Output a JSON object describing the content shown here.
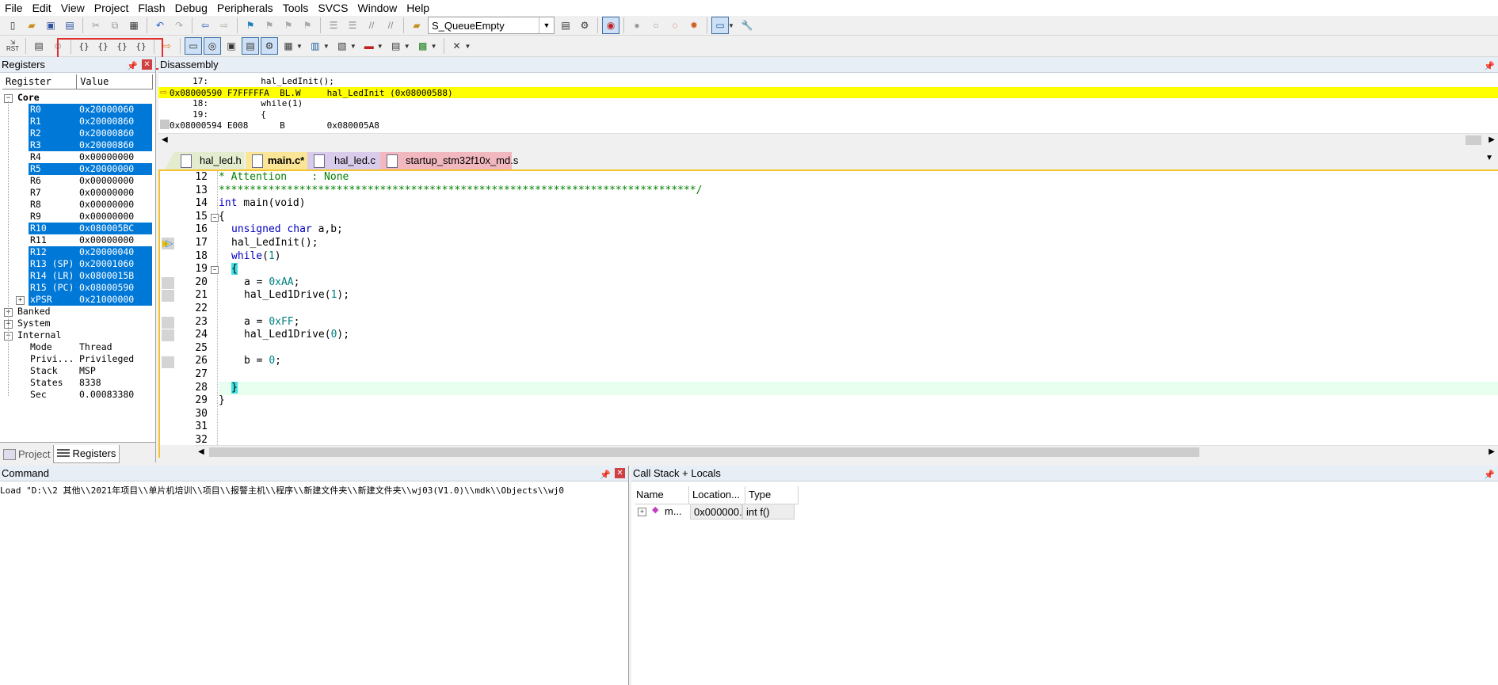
{
  "menu": [
    "File",
    "Edit",
    "View",
    "Project",
    "Flash",
    "Debug",
    "Peripherals",
    "Tools",
    "SVCS",
    "Window",
    "Help"
  ],
  "toolbar": {
    "target": "S_QueueEmpty",
    "rst_label": "RST"
  },
  "registers": {
    "title": "Registers",
    "col_register": "Register",
    "col_value": "Value",
    "core_label": "Core",
    "core": [
      {
        "name": "R0",
        "value": "0x20000060",
        "sel": true
      },
      {
        "name": "R1",
        "value": "0x20000860",
        "sel": true
      },
      {
        "name": "R2",
        "value": "0x20000860",
        "sel": true
      },
      {
        "name": "R3",
        "value": "0x20000860",
        "sel": true
      },
      {
        "name": "R4",
        "value": "0x00000000",
        "sel": false
      },
      {
        "name": "R5",
        "value": "0x20000000",
        "sel": true
      },
      {
        "name": "R6",
        "value": "0x00000000",
        "sel": false
      },
      {
        "name": "R7",
        "value": "0x00000000",
        "sel": false
      },
      {
        "name": "R8",
        "value": "0x00000000",
        "sel": false
      },
      {
        "name": "R9",
        "value": "0x00000000",
        "sel": false
      },
      {
        "name": "R10",
        "value": "0x080005BC",
        "sel": true
      },
      {
        "name": "R11",
        "value": "0x00000000",
        "sel": false
      },
      {
        "name": "R12",
        "value": "0x20000040",
        "sel": true
      },
      {
        "name": "R13 (SP)",
        "value": "0x20001060",
        "sel": true
      },
      {
        "name": "R14 (LR)",
        "value": "0x0800015B",
        "sel": true
      },
      {
        "name": "R15 (PC)",
        "value": "0x08000590",
        "sel": true
      },
      {
        "name": "xPSR",
        "value": "0x21000000",
        "sel": true
      }
    ],
    "banked_label": "Banked",
    "system_label": "System",
    "internal_label": "Internal",
    "internal": [
      {
        "name": "Mode",
        "value": "Thread"
      },
      {
        "name": "Privi...",
        "value": "Privileged"
      },
      {
        "name": "Stack",
        "value": "MSP"
      },
      {
        "name": "States",
        "value": "8338"
      },
      {
        "name": "Sec",
        "value": "0.00083380"
      }
    ],
    "tab_project": "Project",
    "tab_registers": "Registers"
  },
  "disassembly": {
    "title": "Disassembly",
    "lines": [
      "     17:          hal_LedInit();",
      "0x08000590 F7FFFFFA  BL.W     hal_LedInit (0x08000588)",
      "     18:          while(1)",
      "     19:          {",
      "0x08000594 E008      B        0x080005A8"
    ]
  },
  "editor_tabs": [
    "hal_led.h",
    "main.c*",
    "hal_led.c",
    "startup_stm32f10x_md.s"
  ],
  "code": {
    "line_numbers": [
      "12",
      "13",
      "14",
      "15",
      "16",
      "17",
      "18",
      "19",
      "20",
      "21",
      "22",
      "23",
      "24",
      "25",
      "26",
      "27",
      "28",
      "29",
      "30",
      "31",
      "32"
    ],
    "l12": "* Attention    : None",
    "l13": "*****************************************************************************/",
    "l14_kw": "int",
    "l14_rest": " main(void)",
    "l15": "{",
    "l16_kw": "unsigned char",
    "l16_rest": " a,b;",
    "l17": "hal_LedInit();",
    "l18_kw": "while",
    "l18_p1": "(",
    "l18_num": "1",
    "l18_p2": ")",
    "l19": "{",
    "l20_a": "a = ",
    "l20_num": "0xAA",
    "l20_b": ";",
    "l21_a": "hal_Led1Drive(",
    "l21_num": "1",
    "l21_b": ");",
    "l23_a": "a = ",
    "l23_num": "0xFF",
    "l23_b": ";",
    "l24_a": "hal_Led1Drive(",
    "l24_num": "0",
    "l24_b": ");",
    "l26_a": "b = ",
    "l26_num": "0",
    "l26_b": ";",
    "l28": "}",
    "l29": "}"
  },
  "command": {
    "title": "Command",
    "text": "Load \"D:\\\\2 其他\\\\2021年项目\\\\单片机培训\\\\项目\\\\报警主机\\\\程序\\\\新建文件夹\\\\新建文件夹\\\\wj03(V1.0)\\\\mdk\\\\Objects\\\\wj0"
  },
  "callstack": {
    "title": "Call Stack + Locals",
    "col_name": "Name",
    "col_location": "Location...",
    "col_type": "Type",
    "row_name": "m...",
    "row_location": "0x000000...",
    "row_type": "int f()"
  },
  "colors": {
    "selection": "#0078d7",
    "current_line": "#ffff00",
    "highlight_line": "#e8fff0",
    "annotation": "#e03030"
  }
}
